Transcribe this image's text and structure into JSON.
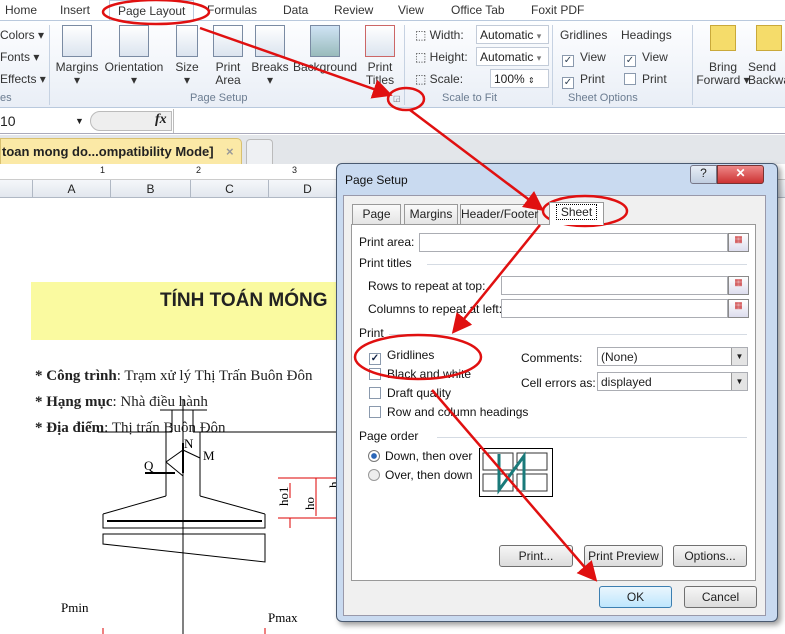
{
  "ribbon_tabs": [
    "Home",
    "Insert",
    "Page Layout",
    "Formulas",
    "Data",
    "Review",
    "View",
    "Office Tab",
    "Foxit PDF"
  ],
  "themes": {
    "colors": "Colors",
    "fonts": "Fonts",
    "effects": "Effects",
    "group_label": "es"
  },
  "page_setup": {
    "margins": "Margins",
    "orientation": "Orientation",
    "size": "Size",
    "print_area": "Print Area",
    "breaks": "Breaks",
    "background": "Background",
    "print_titles": "Print Titles",
    "group_label": "Page Setup"
  },
  "scale_to_fit": {
    "width_label": "Width:",
    "width_value": "Automatic",
    "height_label": "Height:",
    "height_value": "Automatic",
    "scale_label": "Scale:",
    "scale_value": "100%",
    "group_label": "Scale to Fit"
  },
  "sheet_options": {
    "gridlines": "Gridlines",
    "headings": "Headings",
    "view": "View",
    "print": "Print",
    "gridlines_view": true,
    "gridlines_print": true,
    "headings_view": true,
    "headings_print": false,
    "group_label": "Sheet Options"
  },
  "arrange": {
    "bring_forward": "Bring Forward",
    "send_backward": "Send Backward"
  },
  "formula_bar": {
    "name_box": "10",
    "fx": "fx",
    "value": ""
  },
  "workbook_tab": {
    "title": "toan mong do...ompatibility Mode]",
    "close": "×"
  },
  "ruler": [
    "1",
    "2",
    "3"
  ],
  "columns": [
    "A",
    "B",
    "C",
    "D"
  ],
  "sheet": {
    "title": "TÍNH TOÁN MÓNG",
    "lines": [
      {
        "label": "* Công trình",
        "value": ": Trạm xử lý Thị Trấn Buôn Đôn"
      },
      {
        "label": "* Hạng mục",
        "value": ":  Nhà điều hành"
      },
      {
        "label": "* Địa điểm",
        "value": ":  Thị trấn Buôn Đôn"
      }
    ],
    "diagram": {
      "N": "N",
      "M": "M",
      "Q": "Q",
      "ho1": "ho1",
      "ho": "ho",
      "h": "h",
      "pmin": "Pmin",
      "pmax": "Pmax"
    }
  },
  "dialog": {
    "title": "Page Setup",
    "help": "?",
    "close": "✕",
    "tabs": [
      "Page",
      "Margins",
      "Header/Footer",
      "Sheet"
    ],
    "active_tab": "Sheet",
    "print_area_label": "Print area:",
    "print_area_value": "",
    "print_titles_label": "Print titles",
    "rows_label": "Rows to repeat at top:",
    "rows_value": "",
    "cols_label": "Columns to repeat at left:",
    "cols_value": "",
    "print_label": "Print",
    "checks": [
      {
        "label": "Gridlines",
        "checked": true
      },
      {
        "label": "Black and white",
        "checked": false
      },
      {
        "label": "Draft quality",
        "checked": false
      },
      {
        "label": "Row and column headings",
        "checked": false
      }
    ],
    "comments_label": "Comments:",
    "comments_value": "(None)",
    "errors_label": "Cell errors as:",
    "errors_value": "displayed",
    "page_order_label": "Page order",
    "radios": [
      {
        "label": "Down, then over",
        "selected": true
      },
      {
        "label": "Over, then down",
        "selected": false
      }
    ],
    "buttons": {
      "print": "Print...",
      "preview": "Print Preview",
      "options": "Options...",
      "ok": "OK",
      "cancel": "Cancel"
    }
  },
  "colors": {
    "annotation": "#e01010",
    "title_band": "#fafaa0",
    "tab_yellow": "#fbe9a6"
  }
}
